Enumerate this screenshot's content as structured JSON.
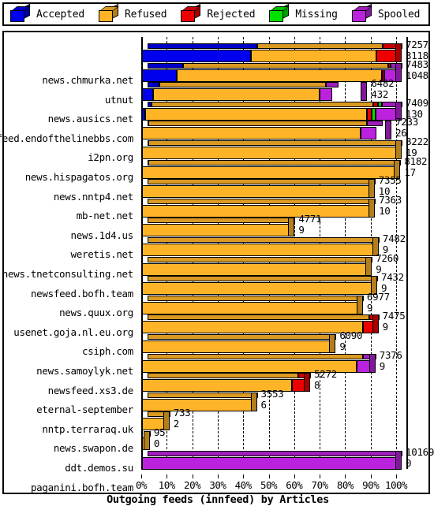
{
  "legend": {
    "items": [
      {
        "label": "Accepted",
        "color": "#0000ee",
        "icon": "cube-icon"
      },
      {
        "label": "Refused",
        "color": "#ffb428",
        "icon": "cube-icon"
      },
      {
        "label": "Rejected",
        "color": "#ee0000",
        "icon": "cube-icon"
      },
      {
        "label": "Missing",
        "color": "#00e000",
        "icon": "cube-icon"
      },
      {
        "label": "Spooled",
        "color": "#bb22dd",
        "icon": "cube-icon"
      }
    ]
  },
  "chart_data": {
    "type": "bar",
    "title": "Outgoing feeds (innfeed) by Articles",
    "xlabel": "Outgoing feeds (innfeed) by Articles",
    "ylabel": "",
    "orientation": "horizontal",
    "stacked": true,
    "normalized": true,
    "grid": true,
    "legend_position": "top",
    "xlim": [
      0,
      100
    ],
    "xticks": [
      0,
      10,
      20,
      30,
      40,
      50,
      60,
      70,
      80,
      90,
      100
    ],
    "xticklabels": [
      "0%",
      "10%",
      "20%",
      "30%",
      "40%",
      "50%",
      "60%",
      "70%",
      "80%",
      "90%",
      "100%"
    ],
    "series_names": [
      "Accepted",
      "Refused",
      "Rejected",
      "Missing",
      "Spooled"
    ],
    "series_colors": [
      "#0000ee",
      "#ffb428",
      "#ee0000",
      "#00e000",
      "#bb22dd"
    ],
    "categories": [
      "news.chmurka.net",
      "utnut",
      "news.ausics.net",
      "newsfeed.endofthelinebbs.com",
      "i2pn.org",
      "news.hispagatos.org",
      "news.nntp4.net",
      "mb-net.net",
      "news.1d4.us",
      "weretis.net",
      "news.tnetconsulting.net",
      "newsfeed.bofh.team",
      "news.quux.org",
      "usenet.goja.nl.eu.org",
      "csiph.com",
      "news.samoylyk.net",
      "newsfeed.xs3.de",
      "eternal-september",
      "nntp.terraraq.uk",
      "news.swapon.de",
      "ddt.demos.su",
      "paganini.bofh.team"
    ],
    "rows": [
      {
        "label": "news.chmurka.net",
        "total": 7257,
        "secondary": 3118,
        "bar_pct": 100.0,
        "pcts": [
          42.9,
          49.5,
          7.6,
          0.0,
          0.0
        ]
      },
      {
        "label": "utnut",
        "total": 7483,
        "secondary": 1048,
        "bar_pct": 100.0,
        "pcts": [
          13.9,
          80.4,
          1.1,
          0.0,
          4.6
        ]
      },
      {
        "label": "news.ausics.net",
        "total": 6482,
        "secondary": 432,
        "bar_pct": 86.5,
        "pcts": [
          5.3,
          75.5,
          0.0,
          0.0,
          5.7
        ]
      },
      {
        "label": "newsfeed.endofthelinebbs.com",
        "total": 7409,
        "secondary": 130,
        "bar_pct": 100.0,
        "pcts": [
          1.4,
          87.0,
          2.0,
          1.6,
          8.0
        ]
      },
      {
        "label": "i2pn.org",
        "total": 7233,
        "secondary": 26,
        "bar_pct": 96.0,
        "pcts": [
          0.3,
          89.3,
          0.0,
          0.0,
          6.4
        ]
      },
      {
        "label": "news.hispagatos.org",
        "total": 8222,
        "secondary": 19,
        "bar_pct": 100.0,
        "pcts": [
          0.2,
          99.8,
          0.0,
          0.0,
          0.0
        ]
      },
      {
        "label": "news.nntp4.net",
        "total": 8182,
        "secondary": 17,
        "bar_pct": 99.5,
        "pcts": [
          0.2,
          99.8,
          0.0,
          0.0,
          0.0
        ]
      },
      {
        "label": "mb-net.net",
        "total": 7355,
        "secondary": 10,
        "bar_pct": 89.4,
        "pcts": [
          0.1,
          99.9,
          0.0,
          0.0,
          0.0
        ]
      },
      {
        "label": "news.1d4.us",
        "total": 7363,
        "secondary": 10,
        "bar_pct": 89.5,
        "pcts": [
          0.1,
          99.9,
          0.0,
          0.0,
          0.0
        ]
      },
      {
        "label": "weretis.net",
        "total": 4771,
        "secondary": 9,
        "bar_pct": 58.0,
        "pcts": [
          0.1,
          99.9,
          0.0,
          0.0,
          0.0
        ]
      },
      {
        "label": "news.tnetconsulting.net",
        "total": 7482,
        "secondary": 9,
        "bar_pct": 91.0,
        "pcts": [
          0.1,
          99.9,
          0.0,
          0.0,
          0.0
        ]
      },
      {
        "label": "newsfeed.bofh.team",
        "total": 7260,
        "secondary": 9,
        "bar_pct": 88.3,
        "pcts": [
          0.1,
          99.9,
          0.0,
          0.0,
          0.0
        ]
      },
      {
        "label": "news.quux.org",
        "total": 7432,
        "secondary": 9,
        "bar_pct": 90.4,
        "pcts": [
          0.1,
          99.9,
          0.0,
          0.0,
          0.0
        ]
      },
      {
        "label": "usenet.goja.nl.eu.org",
        "total": 6977,
        "secondary": 9,
        "bar_pct": 84.8,
        "pcts": [
          0.1,
          99.9,
          0.0,
          0.0,
          0.0
        ]
      },
      {
        "label": "csiph.com",
        "total": 7475,
        "secondary": 9,
        "bar_pct": 90.9,
        "pcts": [
          0.1,
          95.5,
          4.4,
          0.0,
          0.0
        ]
      },
      {
        "label": "news.samoylyk.net",
        "total": 6090,
        "secondary": 9,
        "bar_pct": 74.1,
        "pcts": [
          0.1,
          99.9,
          0.0,
          0.0,
          0.0
        ]
      },
      {
        "label": "newsfeed.xs3.de",
        "total": 7376,
        "secondary": 9,
        "bar_pct": 89.7,
        "pcts": [
          0.1,
          94.0,
          0.0,
          0.0,
          5.9
        ]
      },
      {
        "label": "eternal-september",
        "total": 5272,
        "secondary": 8,
        "bar_pct": 64.1,
        "pcts": [
          0.1,
          92.0,
          7.9,
          0.0,
          0.0
        ]
      },
      {
        "label": "nntp.terraraq.uk",
        "total": 3553,
        "secondary": 6,
        "bar_pct": 43.2,
        "pcts": [
          0.1,
          99.9,
          0.0,
          0.0,
          0.0
        ]
      },
      {
        "label": "news.swapon.de",
        "total": 733,
        "secondary": 2,
        "bar_pct": 8.9,
        "pcts": [
          0.1,
          99.9,
          0.0,
          0.0,
          0.0
        ]
      },
      {
        "label": "ddt.demos.su",
        "total": 95,
        "secondary": 0,
        "bar_pct": 1.2,
        "pcts": [
          0.0,
          100.0,
          0.0,
          0.0,
          0.0
        ]
      },
      {
        "label": "paganini.bofh.team",
        "total": 10169,
        "secondary": 0,
        "bar_pct": 100.0,
        "pcts": [
          0.0,
          0.0,
          0.0,
          0.0,
          100.0
        ]
      }
    ]
  }
}
